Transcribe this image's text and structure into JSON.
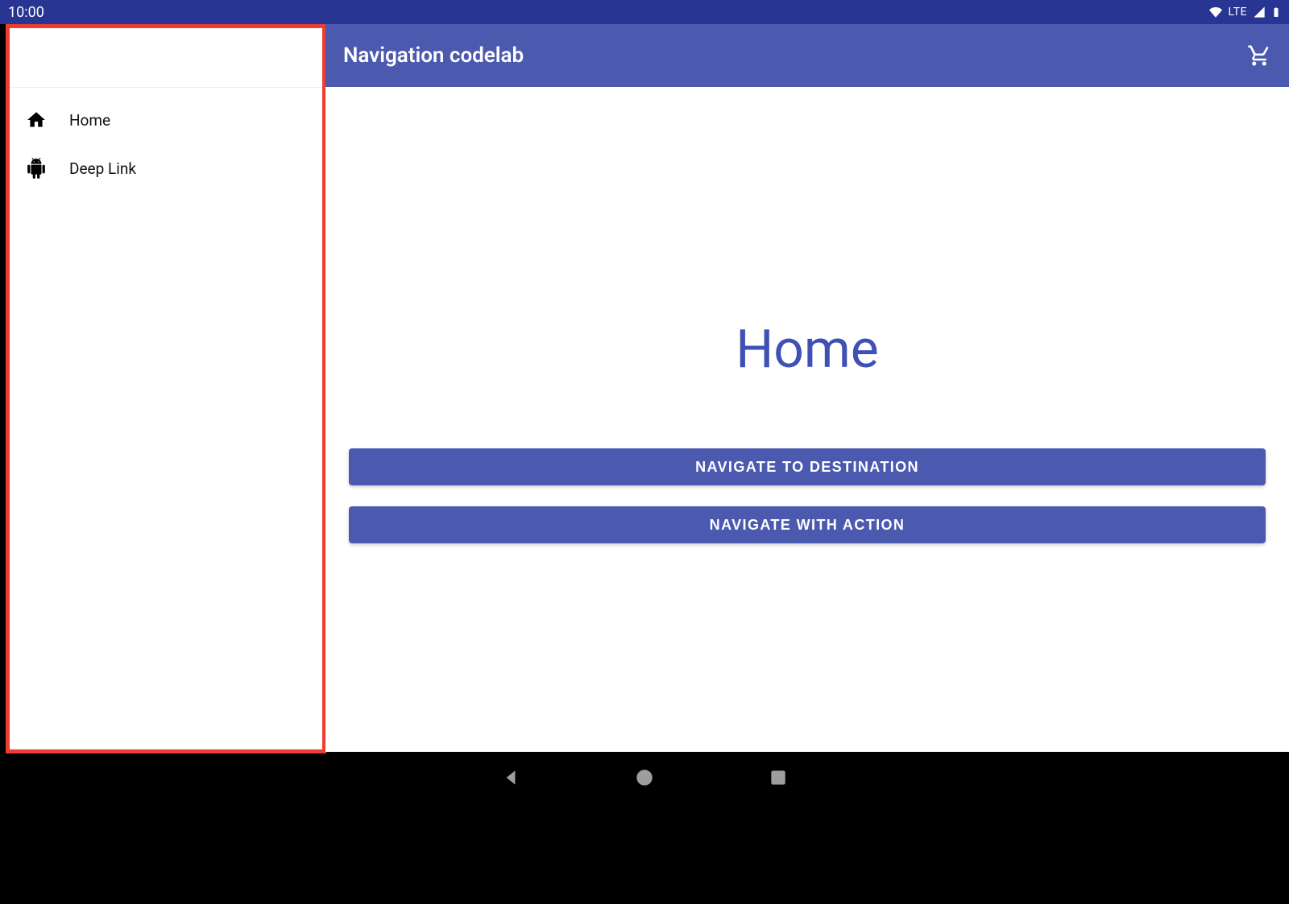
{
  "status_bar": {
    "time": "10:00",
    "network_label": "LTE"
  },
  "app_bar": {
    "title": "Navigation codelab"
  },
  "drawer": {
    "items": [
      {
        "label": "Home",
        "icon": "home"
      },
      {
        "label": "Deep Link",
        "icon": "android"
      }
    ]
  },
  "main": {
    "heading": "Home",
    "buttons": [
      {
        "label": "NAVIGATE TO DESTINATION"
      },
      {
        "label": "NAVIGATE WITH ACTION"
      }
    ]
  },
  "colors": {
    "primary": "#4b59af",
    "primary_dark": "#283593",
    "accent_text": "#3f51b5",
    "highlight_border": "#ef3d2f"
  }
}
